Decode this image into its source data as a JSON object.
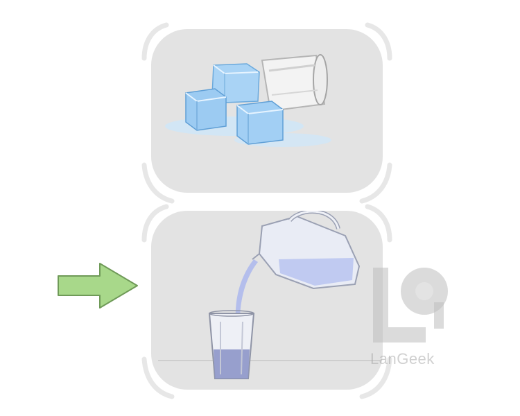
{
  "watermark": {
    "brand_text": "LanGeek",
    "logo_color": "#bdbdbd"
  },
  "panels": {
    "top": {
      "depicts": "ice-cubes-and-tipped-glass",
      "fill": "#e3e3e3"
    },
    "bottom": {
      "depicts": "pitcher-pouring-water-into-glass",
      "fill": "#e3e3e3"
    }
  },
  "arrow": {
    "color": "#a8d88a",
    "outline": "#6f9a58",
    "icon": "right-arrow-icon"
  },
  "colors": {
    "ice": "#a9d3f5",
    "ice_dark": "#6aa9dc",
    "water": "#b8c4f0"
  }
}
